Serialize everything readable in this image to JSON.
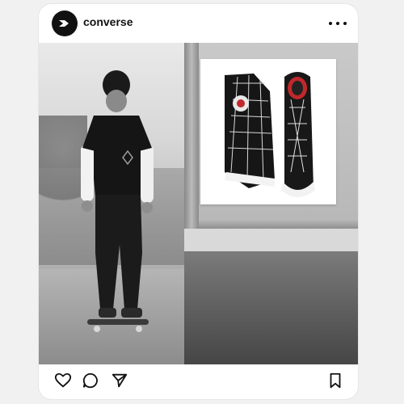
{
  "post": {
    "username": "converse",
    "avatar_icon": "converse-logo-icon",
    "more_icon": "more-options-icon"
  },
  "media": {
    "left_photo": "skater-photo",
    "right_photo": "shoe-product-photo"
  },
  "actions": {
    "like_icon": "heart-icon",
    "comment_icon": "comment-icon",
    "share_icon": "send-icon",
    "save_icon": "bookmark-icon"
  },
  "colors": {
    "card_bg": "#ffffff",
    "page_bg": "#f1f1f1",
    "text": "#111111",
    "accent_red": "#c0282b"
  }
}
